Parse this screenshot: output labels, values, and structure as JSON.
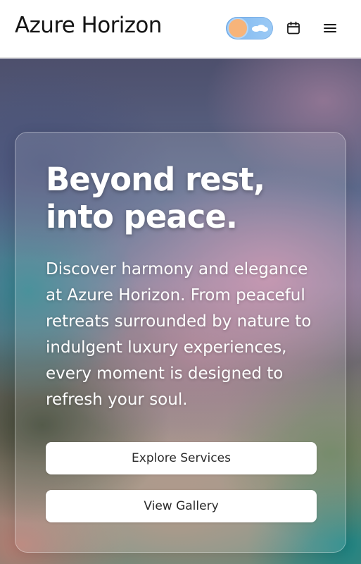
{
  "header": {
    "brand": "Azure Horizon",
    "theme_toggle": {
      "state": "light",
      "icons": [
        "sun-icon",
        "cloud-icon"
      ]
    },
    "calendar_icon": "calendar-icon",
    "menu_icon": "hamburger-menu-icon"
  },
  "hero": {
    "headline": "Beyond rest, into peace.",
    "description": "Discover harmony and elegance at Azure Horizon. From peaceful retreats surrounded by nature to indulgent luxury experiences, every moment is designed to refresh your soul.",
    "buttons": {
      "explore": "Explore Services",
      "gallery": "View Gallery"
    }
  },
  "colors": {
    "header_bg": "#ffffff",
    "brand_text": "#141414",
    "toggle_bg": "#7fb8f0",
    "sun": "#f7b47a",
    "button_bg": "#ffffff",
    "hero_text": "#ffffff"
  }
}
